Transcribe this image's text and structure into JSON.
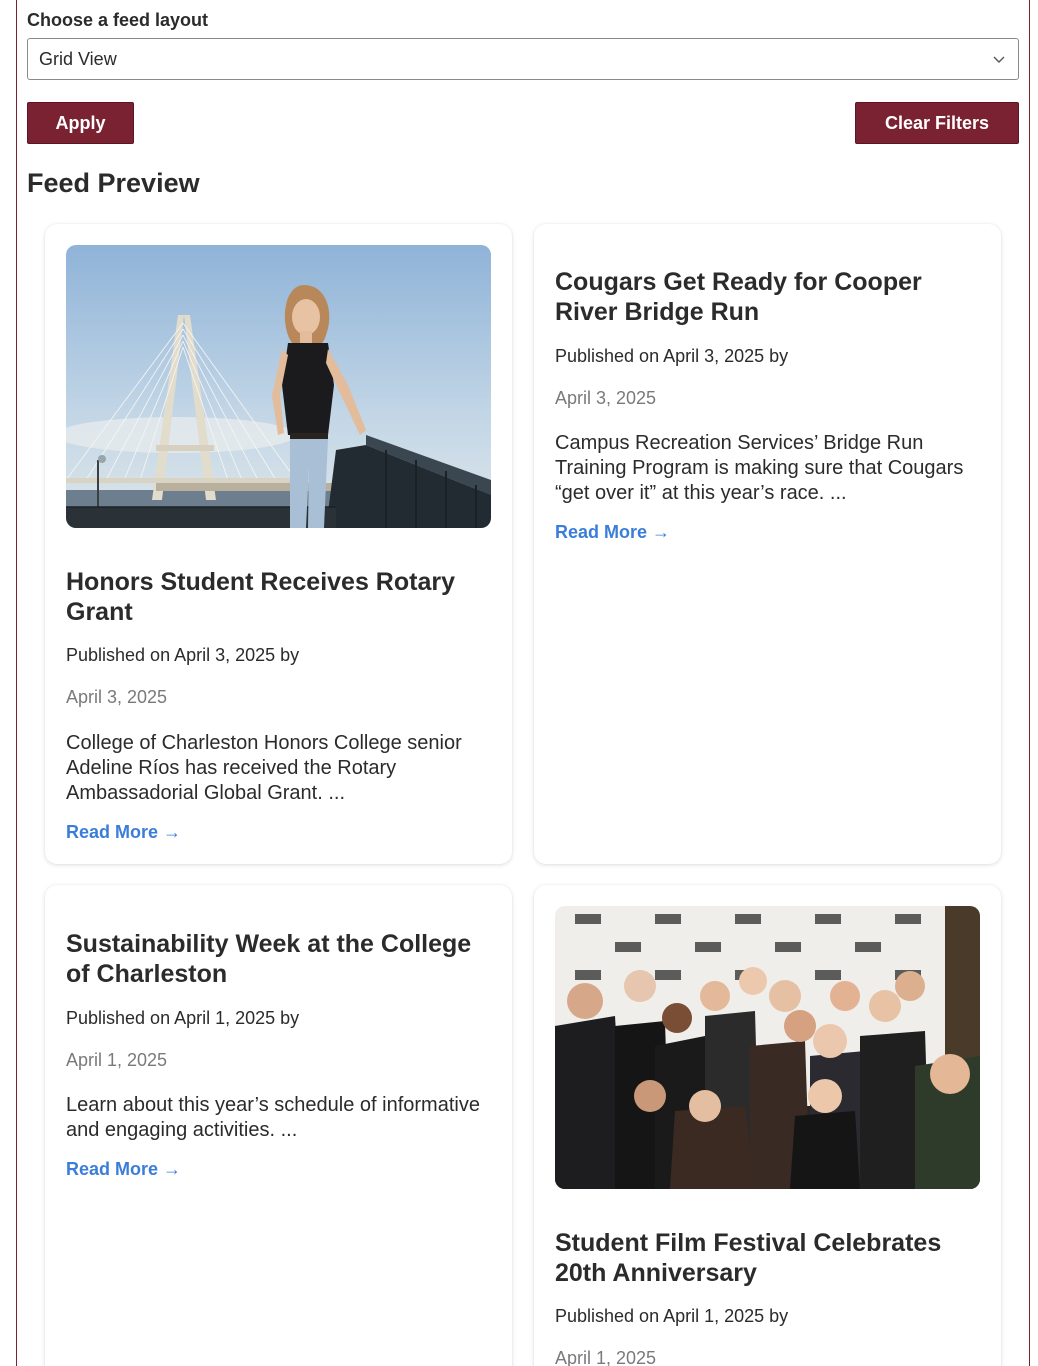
{
  "filter": {
    "label": "Choose a feed layout",
    "selected": "Grid View",
    "apply_label": "Apply",
    "clear_label": "Clear Filters"
  },
  "preview": {
    "heading": "Feed Preview",
    "cards": [
      {
        "title": "Honors Student Receives Rotary Grant",
        "published": "Published on April 3, 2025 by",
        "date": "April 3, 2025",
        "description": "College of Charleston Honors College senior Adeline Ríos has received the Rotary Ambassadorial Global Grant. ...",
        "link": "Read More →",
        "has_image": true,
        "image": "woman-on-pier-with-cable-stayed-bridge"
      },
      {
        "title": "Cougars Get Ready for Cooper River Bridge Run",
        "published": "Published on April 3, 2025 by",
        "date": "April 3, 2025",
        "description": "Campus Recreation Services’ Bridge Run Training Program is making sure that Cougars “get over it” at this year’s race. ...",
        "link": "Read More →",
        "has_image": false
      },
      {
        "title": "Sustainability Week at the College of Charleston",
        "published": "Published on April 1, 2025 by",
        "date": "April 1, 2025",
        "description": "Learn about this year’s schedule of informative and engaging activities. ...",
        "link": "Read More →",
        "has_image": false
      },
      {
        "title": "Student Film Festival Celebrates 20th Anniversary",
        "published": "Published on April 1, 2025 by",
        "date": "April 1, 2025",
        "description": "",
        "link": "",
        "has_image": true,
        "image": "group-photo-at-film-club-backdrop"
      }
    ]
  },
  "colors": {
    "accent": "#7a2232",
    "link": "#3b7dd8",
    "muted": "#7a7a7a"
  },
  "icons": {
    "select": "chevron-down-icon",
    "link_arrow": "arrow-right-icon"
  }
}
